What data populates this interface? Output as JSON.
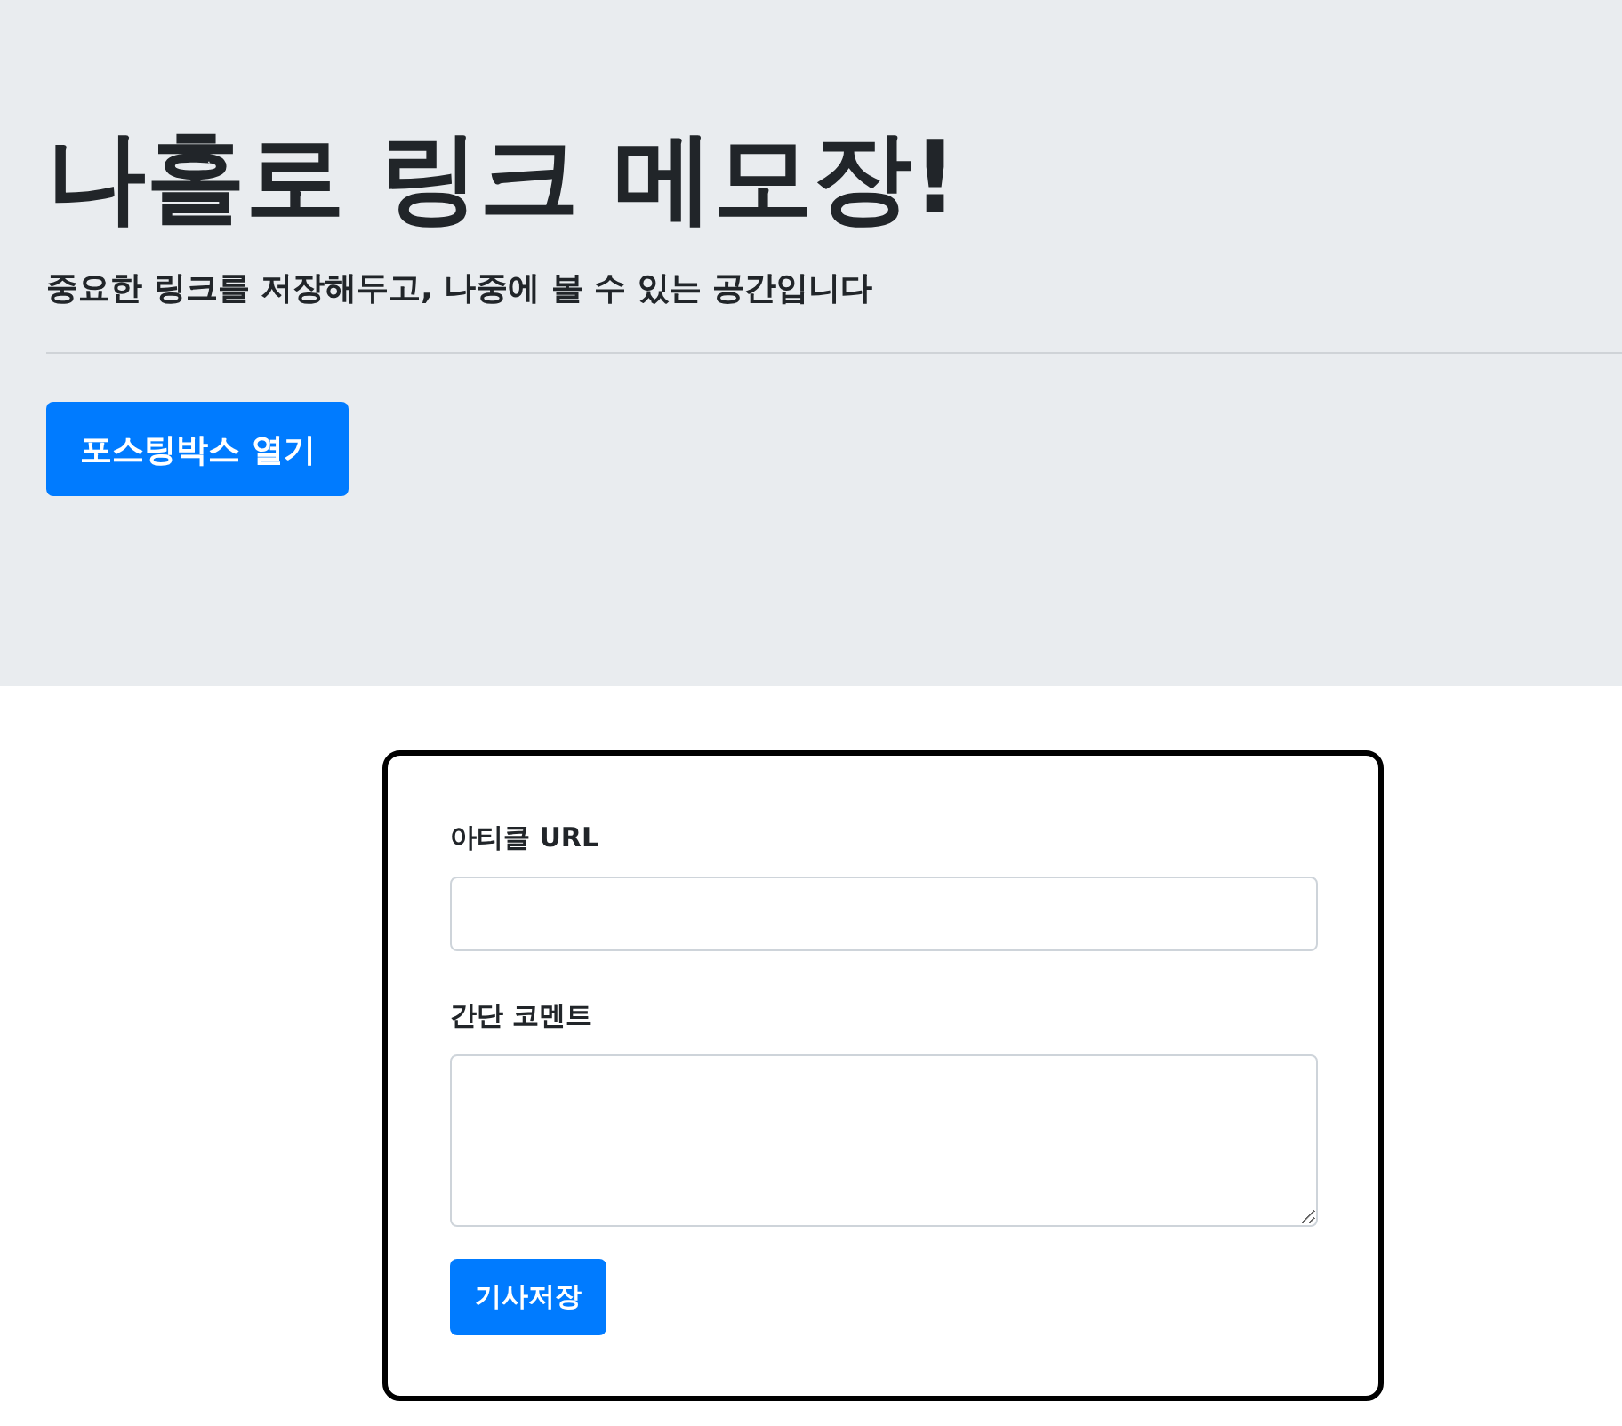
{
  "header": {
    "title": "나홀로 링크 메모장!",
    "subtitle": "중요한 링크를 저장해두고, 나중에 볼 수 있는 공간입니다",
    "button": "포스팅박스 열기"
  },
  "posting_box": {
    "fields": [
      {
        "kind": "input",
        "label": "아티클 URL"
      },
      {
        "kind": "textarea",
        "label": "간단 코멘트"
      }
    ],
    "button": "기사저장"
  }
}
